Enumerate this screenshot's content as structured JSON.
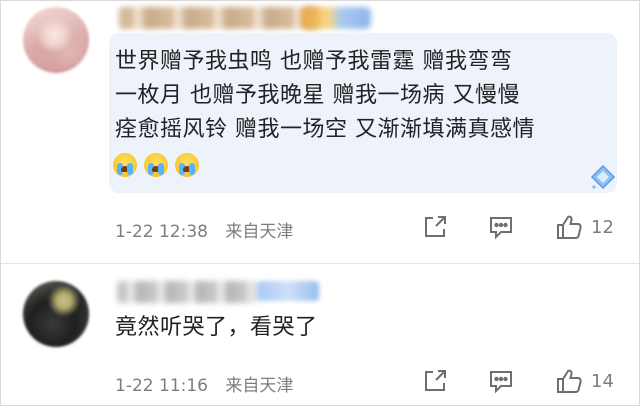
{
  "comments": [
    {
      "lines": [
        "世界赠予我虫鸣 也赠予我雷霆 赠我弯弯",
        "一枚月 也赠予我晚星 赠我一场病 又慢慢",
        "痊愈摇风铃 赠我一场空 又渐渐填满真感情"
      ],
      "emoji": [
        "crying-face",
        "crying-face",
        "crying-face"
      ],
      "date": "1-22 12:38",
      "location": "来自天津",
      "likes": "12"
    },
    {
      "lines": [
        "竟然听哭了，看哭了"
      ],
      "date": "1-22 11:16",
      "location": "来自天津",
      "likes": "14"
    }
  ],
  "icons": {
    "share": "share-icon",
    "comment": "comment-icon",
    "like": "thumbs-up-icon",
    "badge": "diamond-badge-icon"
  },
  "colors": {
    "bubble": "#eef3fb",
    "meta_text": "#7d7d7d",
    "body_text": "#222222"
  }
}
